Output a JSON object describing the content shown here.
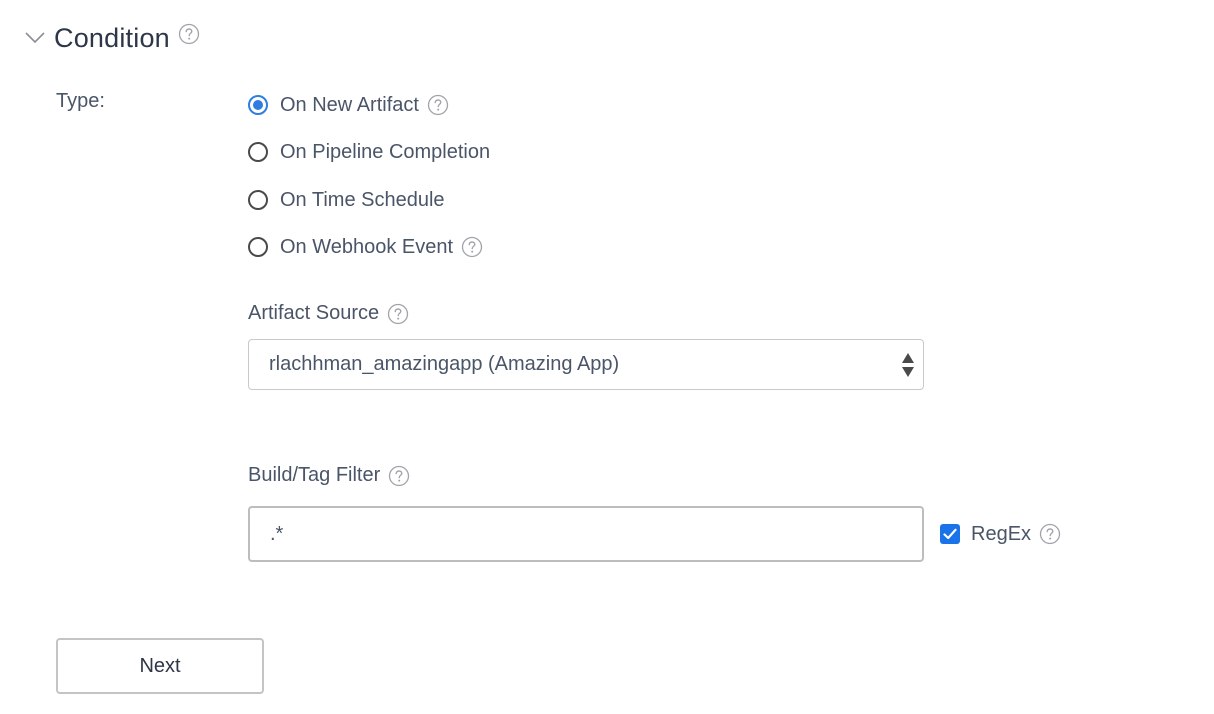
{
  "section": {
    "title": "Condition",
    "expanded": true
  },
  "type_field": {
    "label": "Type:",
    "options": [
      {
        "label": "On New Artifact",
        "selected": true,
        "has_help": true
      },
      {
        "label": "On Pipeline Completion",
        "selected": false,
        "has_help": false
      },
      {
        "label": "On Time Schedule",
        "selected": false,
        "has_help": false
      },
      {
        "label": "On Webhook Event",
        "selected": false,
        "has_help": true
      }
    ]
  },
  "artifact_source": {
    "label": "Artifact Source",
    "value": "rlachhman_amazingapp (Amazing App)"
  },
  "build_tag_filter": {
    "label": "Build/Tag Filter",
    "value": ".*"
  },
  "regex": {
    "label": "RegEx",
    "checked": true
  },
  "actions": {
    "next_label": "Next"
  },
  "colors": {
    "accent": "#2f7de1",
    "checkbox": "#1a73e8",
    "text": "#4a5568",
    "border": "#c9c9c9"
  },
  "icons": {
    "collapse": "chevron-down-icon",
    "help": "question-circle-icon",
    "select": "sort-arrows-icon",
    "check": "checkmark-icon"
  }
}
